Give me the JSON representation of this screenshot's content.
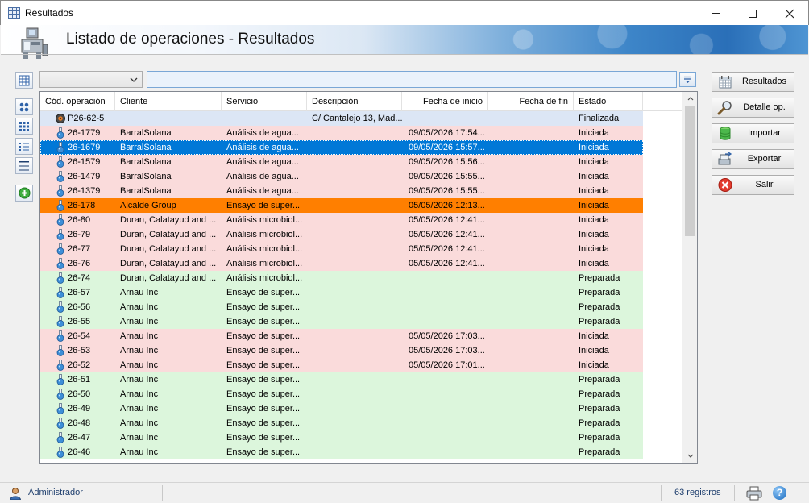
{
  "window": {
    "title": "Resultados"
  },
  "header": {
    "heading": "Listado de operaciones - Resultados"
  },
  "filter": {
    "combo_value": "",
    "search_value": "",
    "search_placeholder": ""
  },
  "grid": {
    "columns": [
      {
        "key": "code",
        "label": "Cód. operación"
      },
      {
        "key": "client",
        "label": "Cliente"
      },
      {
        "key": "service",
        "label": "Servicio"
      },
      {
        "key": "description",
        "label": "Descripción"
      },
      {
        "key": "start",
        "label": "Fecha de inicio"
      },
      {
        "key": "end",
        "label": "Fecha de fin"
      },
      {
        "key": "status",
        "label": "Estado"
      }
    ],
    "rows": [
      {
        "code": "P26-62-5",
        "client": "",
        "service": "",
        "description": "C/ Cantalejo 13, Mad...",
        "start": "",
        "end": "",
        "status": "Finalizada",
        "state": "finalizada",
        "icon": "record-icon"
      },
      {
        "code": "26-1779",
        "client": "BarralSolana",
        "service": "Análisis de agua...",
        "description": "",
        "start": "09/05/2026 17:54...",
        "end": "",
        "status": "Iniciada",
        "state": "iniciada",
        "icon": "flask-icon"
      },
      {
        "code": "26-1679",
        "client": "BarralSolana",
        "service": "Análisis de agua...",
        "description": "",
        "start": "09/05/2026 15:57...",
        "end": "",
        "status": "Iniciada",
        "state": "selected",
        "icon": "flask-icon"
      },
      {
        "code": "26-1579",
        "client": "BarralSolana",
        "service": "Análisis de agua...",
        "description": "",
        "start": "09/05/2026 15:56...",
        "end": "",
        "status": "Iniciada",
        "state": "iniciada",
        "icon": "flask-icon"
      },
      {
        "code": "26-1479",
        "client": "BarralSolana",
        "service": "Análisis de agua...",
        "description": "",
        "start": "09/05/2026 15:55...",
        "end": "",
        "status": "Iniciada",
        "state": "iniciada",
        "icon": "flask-icon"
      },
      {
        "code": "26-1379",
        "client": "BarralSolana",
        "service": "Análisis de agua...",
        "description": "",
        "start": "09/05/2026 15:55...",
        "end": "",
        "status": "Iniciada",
        "state": "iniciada",
        "icon": "flask-icon"
      },
      {
        "code": "26-178",
        "client": "Alcalde Group",
        "service": "Ensayo de super...",
        "description": "",
        "start": "05/05/2026 12:13...",
        "end": "",
        "status": "Iniciada",
        "state": "highlight",
        "icon": "flask-icon"
      },
      {
        "code": "26-80",
        "client": "Duran, Calatayud and ...",
        "service": "Análisis microbiol...",
        "description": "",
        "start": "05/05/2026 12:41...",
        "end": "",
        "status": "Iniciada",
        "state": "iniciada",
        "icon": "flask-icon"
      },
      {
        "code": "26-79",
        "client": "Duran, Calatayud and ...",
        "service": "Análisis microbiol...",
        "description": "",
        "start": "05/05/2026 12:41...",
        "end": "",
        "status": "Iniciada",
        "state": "iniciada",
        "icon": "flask-icon"
      },
      {
        "code": "26-77",
        "client": "Duran, Calatayud and ...",
        "service": "Análisis microbiol...",
        "description": "",
        "start": "05/05/2026 12:41...",
        "end": "",
        "status": "Iniciada",
        "state": "iniciada",
        "icon": "flask-icon"
      },
      {
        "code": "26-76",
        "client": "Duran, Calatayud and ...",
        "service": "Análisis microbiol...",
        "description": "",
        "start": "05/05/2026 12:41...",
        "end": "",
        "status": "Iniciada",
        "state": "iniciada",
        "icon": "flask-icon"
      },
      {
        "code": "26-74",
        "client": "Duran, Calatayud and ...",
        "service": "Análisis microbiol...",
        "description": "",
        "start": "",
        "end": "",
        "status": "Preparada",
        "state": "preparada",
        "icon": "flask-icon"
      },
      {
        "code": "26-57",
        "client": "Arnau Inc",
        "service": "Ensayo de super...",
        "description": "",
        "start": "",
        "end": "",
        "status": "Preparada",
        "state": "preparada",
        "icon": "flask-icon"
      },
      {
        "code": "26-56",
        "client": "Arnau Inc",
        "service": "Ensayo de super...",
        "description": "",
        "start": "",
        "end": "",
        "status": "Preparada",
        "state": "preparada",
        "icon": "flask-icon"
      },
      {
        "code": "26-55",
        "client": "Arnau Inc",
        "service": "Ensayo de super...",
        "description": "",
        "start": "",
        "end": "",
        "status": "Preparada",
        "state": "preparada",
        "icon": "flask-icon"
      },
      {
        "code": "26-54",
        "client": "Arnau Inc",
        "service": "Ensayo de super...",
        "description": "",
        "start": "05/05/2026 17:03...",
        "end": "",
        "status": "Iniciada",
        "state": "iniciada",
        "icon": "flask-icon"
      },
      {
        "code": "26-53",
        "client": "Arnau Inc",
        "service": "Ensayo de super...",
        "description": "",
        "start": "05/05/2026 17:03...",
        "end": "",
        "status": "Iniciada",
        "state": "iniciada",
        "icon": "flask-icon"
      },
      {
        "code": "26-52",
        "client": "Arnau Inc",
        "service": "Ensayo de super...",
        "description": "",
        "start": "05/05/2026 17:01...",
        "end": "",
        "status": "Iniciada",
        "state": "iniciada",
        "icon": "flask-icon"
      },
      {
        "code": "26-51",
        "client": "Arnau Inc",
        "service": "Ensayo de super...",
        "description": "",
        "start": "",
        "end": "",
        "status": "Preparada",
        "state": "preparada",
        "icon": "flask-icon"
      },
      {
        "code": "26-50",
        "client": "Arnau Inc",
        "service": "Ensayo de super...",
        "description": "",
        "start": "",
        "end": "",
        "status": "Preparada",
        "state": "preparada",
        "icon": "flask-icon"
      },
      {
        "code": "26-49",
        "client": "Arnau Inc",
        "service": "Ensayo de super...",
        "description": "",
        "start": "",
        "end": "",
        "status": "Preparada",
        "state": "preparada",
        "icon": "flask-icon"
      },
      {
        "code": "26-48",
        "client": "Arnau Inc",
        "service": "Ensayo de super...",
        "description": "",
        "start": "",
        "end": "",
        "status": "Preparada",
        "state": "preparada",
        "icon": "flask-icon"
      },
      {
        "code": "26-47",
        "client": "Arnau Inc",
        "service": "Ensayo de super...",
        "description": "",
        "start": "",
        "end": "",
        "status": "Preparada",
        "state": "preparada",
        "icon": "flask-icon"
      },
      {
        "code": "26-46",
        "client": "Arnau Inc",
        "service": "Ensayo de super...",
        "description": "",
        "start": "",
        "end": "",
        "status": "Preparada",
        "state": "preparada",
        "icon": "flask-icon"
      }
    ]
  },
  "actions": {
    "resultados": {
      "label": "Resultados",
      "icon": "calendar-grid-icon"
    },
    "detalle": {
      "label": "Detalle op.",
      "icon": "magnifier-icon"
    },
    "importar": {
      "label": "Importar",
      "icon": "database-import-icon"
    },
    "exportar": {
      "label": "Exportar",
      "icon": "export-icon"
    },
    "salir": {
      "label": "Salir",
      "icon": "close-circle-icon"
    }
  },
  "left_toolbar": [
    "grid-layout-icon",
    "large-icons-view-icon",
    "small-icons-view-icon",
    "list-view-icon",
    "details-view-icon",
    "add-icon"
  ],
  "statusbar": {
    "user": "Administrador",
    "count": "63 registros"
  },
  "colors": {
    "finalizada": "#dce6f5",
    "iniciada": "#fadbdb",
    "preparada": "#dcf6dc",
    "selected": "#0078d7",
    "highlight": "#ff7f00"
  }
}
